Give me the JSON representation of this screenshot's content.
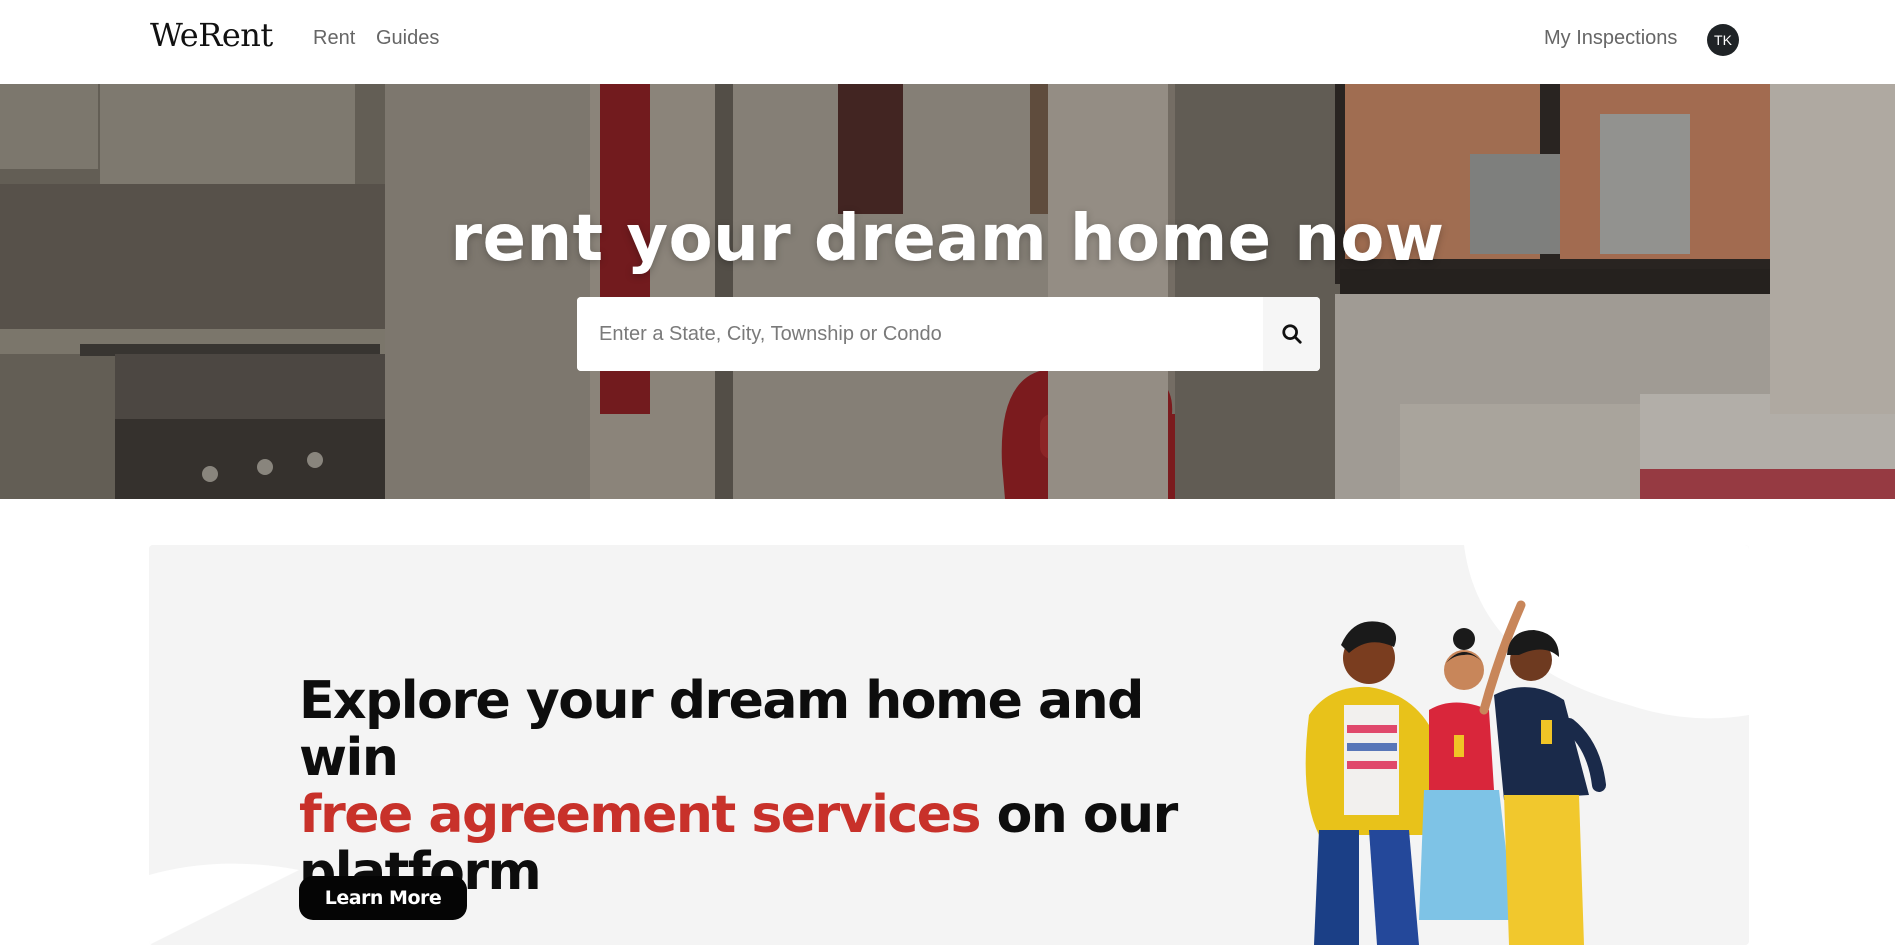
{
  "navbar": {
    "brand": "WeRent",
    "links": [
      "Rent",
      "Guides"
    ],
    "inspections_label": "My Inspections",
    "avatar_initials": "TK"
  },
  "hero": {
    "title": "rent your dream home now",
    "search_placeholder": "Enter a State, City, Township or Condo",
    "search_value": "",
    "search_icon": "search-icon"
  },
  "promo": {
    "headline_part1": "Explore your dream home and win",
    "headline_highlight": "free agreement services",
    "headline_part2": "on our platform",
    "button_label": "Learn More",
    "highlight_color": "#c8312a"
  }
}
